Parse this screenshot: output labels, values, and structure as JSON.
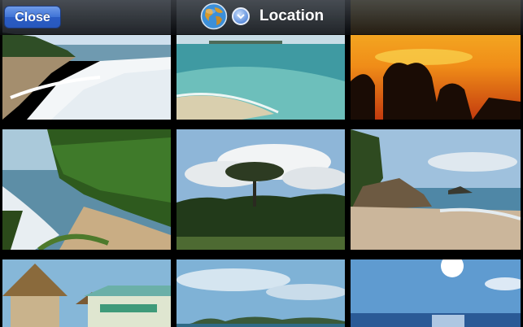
{
  "navbar": {
    "close_label": "Close",
    "title": "Location"
  },
  "icons": {
    "globe": "globe-icon",
    "chevron": "chevron-down-icon"
  },
  "colors": {
    "close_button": "#3f73d6",
    "navbar": "#2a2d33"
  },
  "photos": [
    {
      "scene": "beach-waves"
    },
    {
      "scene": "calm-turquoise-sea"
    },
    {
      "scene": "sunset-silhouette"
    },
    {
      "scene": "palm-beach-cove"
    },
    {
      "scene": "lone-tree-jungle"
    },
    {
      "scene": "rocky-shore"
    },
    {
      "scene": "thatched-huts"
    },
    {
      "scene": "islands-sky"
    },
    {
      "scene": "sunlit-ocean"
    }
  ]
}
